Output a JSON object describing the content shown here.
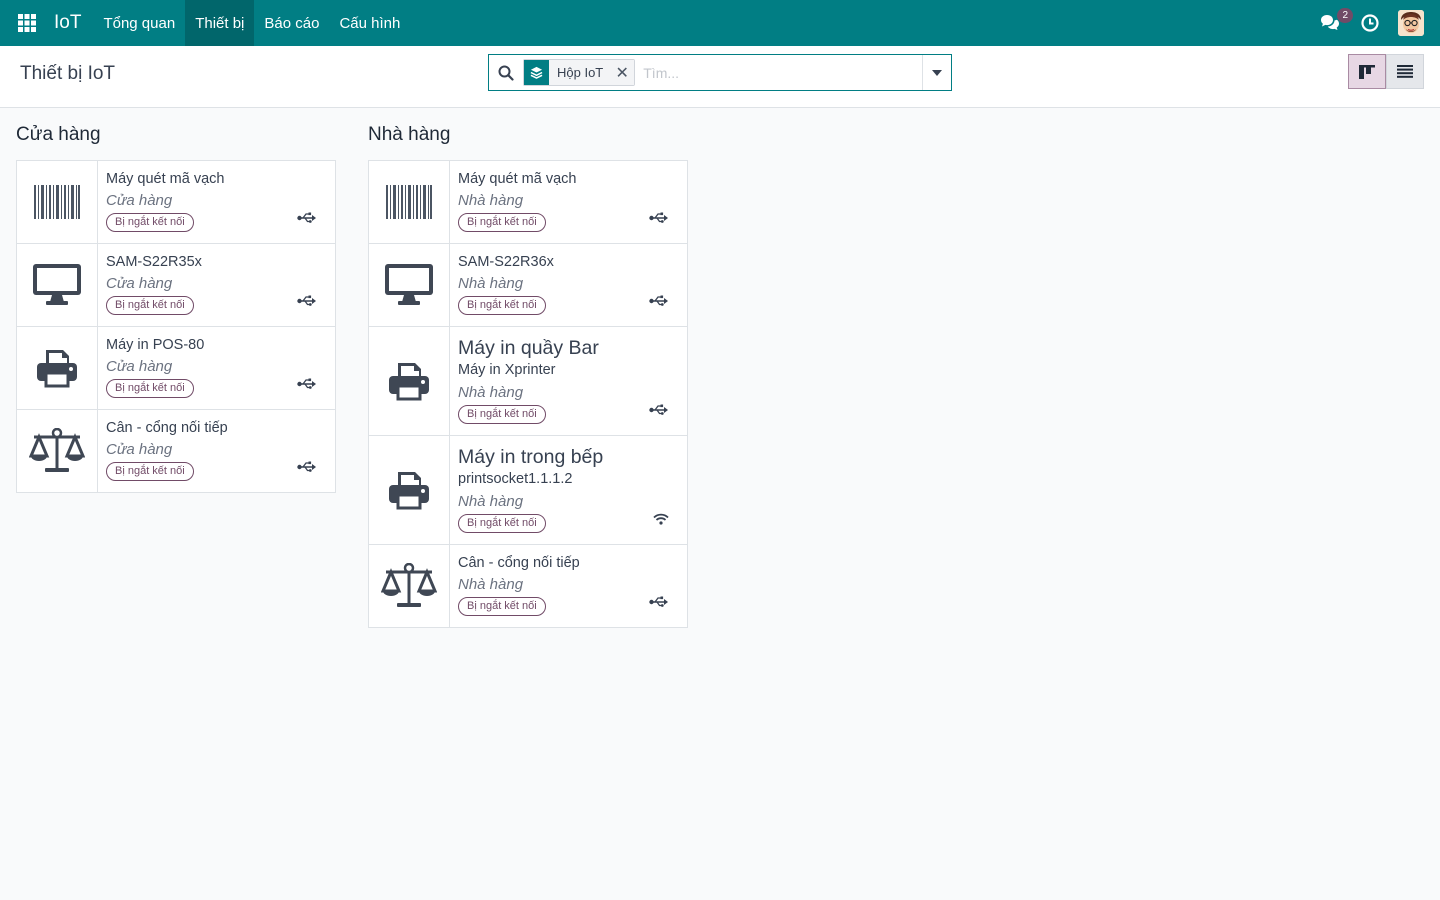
{
  "navbar": {
    "brand": "IoT",
    "menu": [
      "Tổng quan",
      "Thiết bị",
      "Báo cáo",
      "Cấu hình"
    ],
    "active_menu": "Thiết bị",
    "message_count": "2"
  },
  "control": {
    "title": "Thiết bị IoT",
    "facet_label": "Hộp IoT",
    "search_placeholder": "Tìm..."
  },
  "columns": [
    {
      "title": "Cửa hàng",
      "cards": [
        {
          "icon": "barcode-icon",
          "title": "Máy quét mã vạch",
          "location": "Cửa hàng",
          "status": "Bị ngắt kết nối",
          "connection": "usb-icon"
        },
        {
          "icon": "monitor-icon",
          "title": "SAM-S22R35x",
          "location": "Cửa hàng",
          "status": "Bị ngắt kết nối",
          "connection": "usb-icon"
        },
        {
          "icon": "printer-icon",
          "title": "Máy in POS-80",
          "location": "Cửa hàng",
          "status": "Bị ngắt kết nối",
          "connection": "usb-icon"
        },
        {
          "icon": "scale-icon",
          "title": "Cân - cổng nối tiếp",
          "location": "Cửa hàng",
          "status": "Bị ngắt kết nối",
          "connection": "usb-icon"
        }
      ]
    },
    {
      "title": "Nhà hàng",
      "cards": [
        {
          "icon": "barcode-icon",
          "title": "Máy quét mã vạch",
          "location": "Nhà hàng",
          "status": "Bị ngắt kết nối",
          "connection": "usb-icon"
        },
        {
          "icon": "monitor-icon",
          "title": "SAM-S22R36x",
          "location": "Nhà hàng",
          "status": "Bị ngắt kết nối",
          "connection": "usb-icon"
        },
        {
          "icon": "printer-icon",
          "title": "Máy in quầy Bar",
          "subtitle": "Máy in Xprinter",
          "location": "Nhà hàng",
          "status": "Bị ngắt kết nối",
          "connection": "usb-icon"
        },
        {
          "icon": "printer-icon",
          "title": "Máy in trong bếp",
          "subtitle": "printsocket1.1.1.2",
          "location": "Nhà hàng",
          "status": "Bị ngắt kết nối",
          "connection": "wifi-icon"
        },
        {
          "icon": "scale-icon",
          "title": "Cân - cổng nối tiếp",
          "location": "Nhà hàng",
          "status": "Bị ngắt kết nối",
          "connection": "usb-icon"
        }
      ]
    }
  ],
  "colors": {
    "navbar": "#017e84",
    "accent": "#714b67"
  }
}
